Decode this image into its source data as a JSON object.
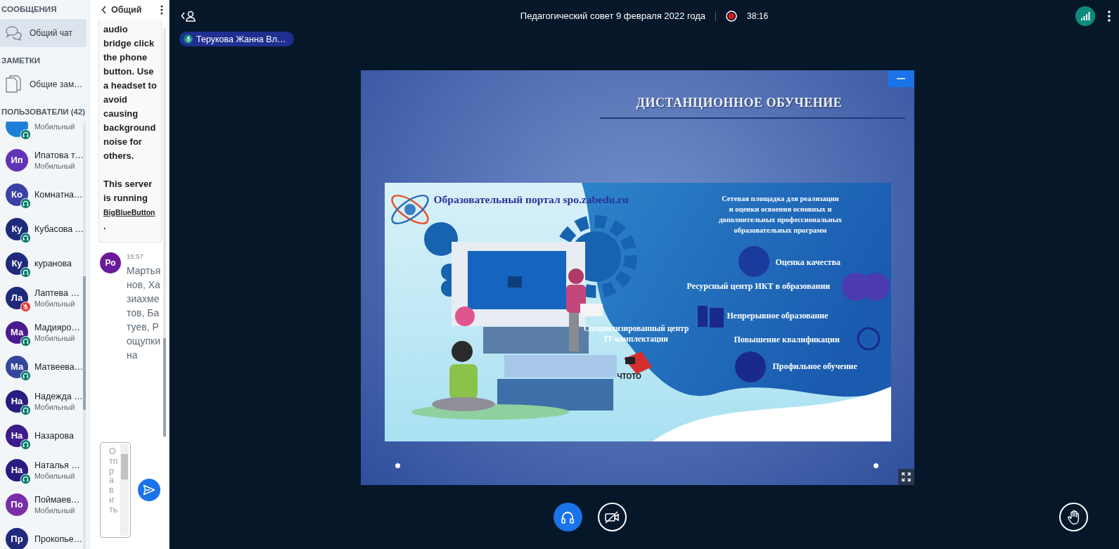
{
  "messages_section": {
    "heading": "СООБЩЕНИЯ",
    "items": [
      {
        "kind": "chat",
        "label": "Общий чат",
        "selected": true
      }
    ]
  },
  "notes_section": {
    "heading": "ЗАМЕТКИ",
    "items": [
      {
        "kind": "notes",
        "label": "Общие зам…",
        "selected": false
      }
    ]
  },
  "users_section": {
    "heading": "ПОЛЬЗОВАТЕЛИ (42)",
    "users": [
      {
        "status": "Мобильный",
        "listen_only": true,
        "muted": false,
        "color": "#1e7fd8"
      },
      {
        "initials": "Ип",
        "name": "Ипатова т…",
        "status": "Мобильный",
        "listen_only": false,
        "muted": false,
        "color": "#5f35b5"
      },
      {
        "initials": "Ко",
        "name": "Комнатна…",
        "listen_only": true,
        "muted": false,
        "color": "#3a41a6"
      },
      {
        "initials": "Ку",
        "name": "Кубасова …",
        "listen_only": true,
        "muted": false,
        "color": "#1f2a7c"
      },
      {
        "initials": "Ку",
        "name": "куранова",
        "listen_only": true,
        "muted": false,
        "color": "#1f2a7c"
      },
      {
        "initials": "Ла",
        "name": "Лаптева …",
        "status": "Мобильный",
        "listen_only": false,
        "muted": true,
        "color": "#1f2a7c"
      },
      {
        "initials": "Ма",
        "name": "Мадияро…",
        "status": "Мобильный",
        "listen_only": true,
        "muted": false,
        "color": "#4b1a8e"
      },
      {
        "initials": "Ма",
        "name": "Матвеева…",
        "listen_only": true,
        "muted": false,
        "color": "#34479e"
      },
      {
        "initials": "На",
        "name": "Надежда …",
        "status": "Мобильный",
        "listen_only": true,
        "muted": false,
        "color": "#2a1b80"
      },
      {
        "initials": "На",
        "name": "Назарова",
        "listen_only": true,
        "muted": false,
        "color": "#3b1a8a"
      },
      {
        "initials": "На",
        "name": "Наталья …",
        "status": "Мобильный",
        "listen_only": true,
        "muted": false,
        "color": "#2a1b80"
      },
      {
        "initials": "По",
        "name": "Поймаев…",
        "status": "Мобильный",
        "listen_only": false,
        "muted": false,
        "color": "#7a2fa8"
      },
      {
        "initials": "Пр",
        "name": "Прокопье…",
        "listen_only": false,
        "muted": false,
        "color": "#1f2a7c"
      }
    ]
  },
  "chat": {
    "title": "Общий",
    "system_message": {
      "text": "audio bridge click the phone button. Use a headset to avoid causing background noise for others.",
      "server_text": "This server is running",
      "link": "BigBlueButton",
      "after": "."
    },
    "messages": [
      {
        "initials": "Ро",
        "color": "#6a1b9a",
        "time": "15:57",
        "text": "Мартьянов, Хазиахметов, Батуев, Рощупкина"
      }
    ],
    "input": {
      "placeholder": "Отправить"
    }
  },
  "top_bar": {
    "title": "Педагогический совет 9 февраля 2022 года",
    "recording": {
      "on": true,
      "time": "38:16"
    }
  },
  "talking": [
    {
      "name": "Терукова Жанна Вл…",
      "muted": false
    }
  ],
  "slide": {
    "title": "ДИСТАНЦИОННОЕ ОБУЧЕНИЕ",
    "portal": "Образовательный портал spo.zabedu.ru",
    "network": "Сетевая площадка для реализации\nи оценки освоения основных и\nдополнительных профессиональных\nобразовательных программ",
    "center": "Специализированный центр\nIT-комплектации",
    "logo_text": "ЧТОТО",
    "items": [
      "Оценка качества",
      "Ресурсный центр ИКТ в образовании",
      "Непрерывное образование",
      "Повышение квалификации",
      "Профильное обучение"
    ]
  },
  "actions": {
    "audio_joined": true,
    "video_on": false
  }
}
